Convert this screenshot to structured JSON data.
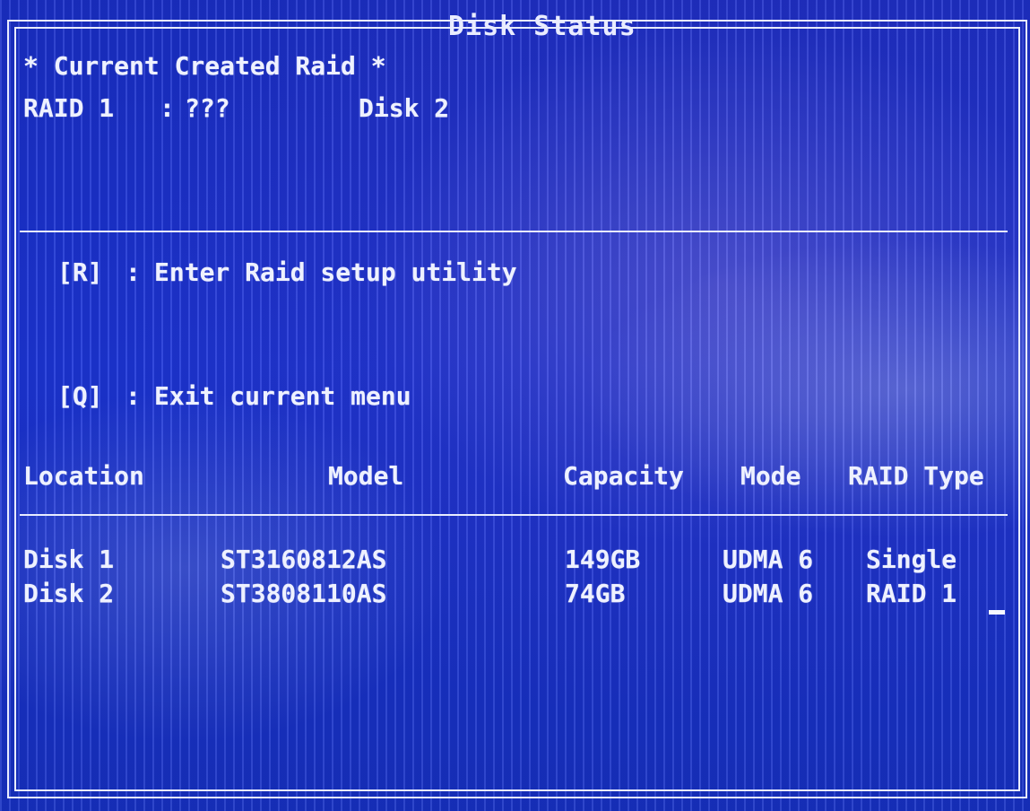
{
  "window": {
    "title": "Disk Status"
  },
  "raid_summary": {
    "heading": "* Current Created Raid *",
    "raid_label": "RAID 1",
    "separator": ":",
    "raid_name": "???",
    "member": "Disk 2"
  },
  "menu": {
    "items": [
      {
        "key": "[R]",
        "separator": ":",
        "label": "Enter Raid setup utility"
      },
      {
        "key": "[Q]",
        "separator": ":",
        "label": "Exit current menu"
      }
    ]
  },
  "table": {
    "columns": [
      "Location",
      "Model",
      "Capacity",
      "Mode",
      "RAID Type"
    ],
    "rows": [
      {
        "location": "Disk 1",
        "model": "ST3160812AS",
        "capacity": "149GB",
        "mode": "UDMA 6",
        "raid_type": "Single"
      },
      {
        "location": "Disk 2",
        "model": "ST3808110AS",
        "capacity": "74GB",
        "mode": "UDMA 6",
        "raid_type": "RAID 1"
      }
    ]
  },
  "colors": {
    "background": "#1c35d8",
    "text": "#eef1ff",
    "frame": "#e8ecff"
  }
}
